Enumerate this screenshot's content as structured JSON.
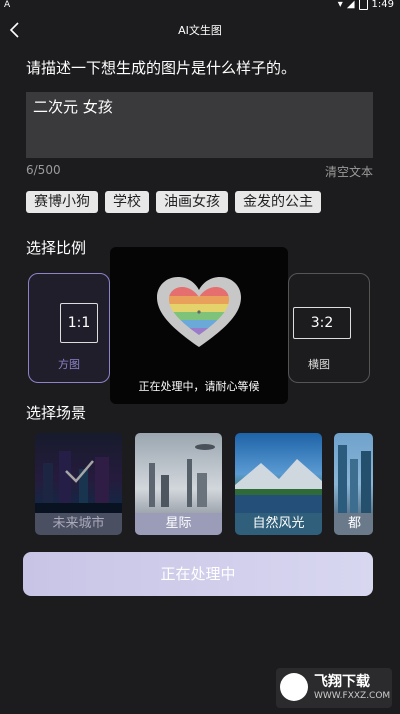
{
  "status_bar": {
    "time": "1:49",
    "left_icon": "A"
  },
  "header": {
    "title": "AI文生图",
    "back_icon": "back-chevron-icon"
  },
  "prompt": {
    "label": "请描述一下想生成的图片是什么样子的。",
    "value": "二次元 女孩",
    "counter": "6/500",
    "clear_label": "清空文本"
  },
  "tags": [
    "赛博小狗",
    "学校",
    "油画女孩",
    "金发的公主"
  ],
  "ratio": {
    "label": "选择比例",
    "options": [
      {
        "ratio": "1:1",
        "name": "方图",
        "selected": true
      },
      {
        "ratio": "3:2",
        "name": "横图",
        "selected": false
      }
    ]
  },
  "scene": {
    "label": "选择场景",
    "items": [
      {
        "name": "未来城市",
        "selected": true
      },
      {
        "name": "星际",
        "selected": false
      },
      {
        "name": "自然风光",
        "selected": false
      },
      {
        "name": "都市",
        "selected": false
      }
    ]
  },
  "main_button": {
    "label": "正在处理中"
  },
  "loading": {
    "message": "正在处理中，请耐心等候"
  },
  "watermark": {
    "brand": "飞翔下载",
    "url": "WWW.FXXZ.COM"
  },
  "colors": {
    "accent": "#8d83c9",
    "background": "#1c1c1e",
    "button": "#cfcbea"
  }
}
